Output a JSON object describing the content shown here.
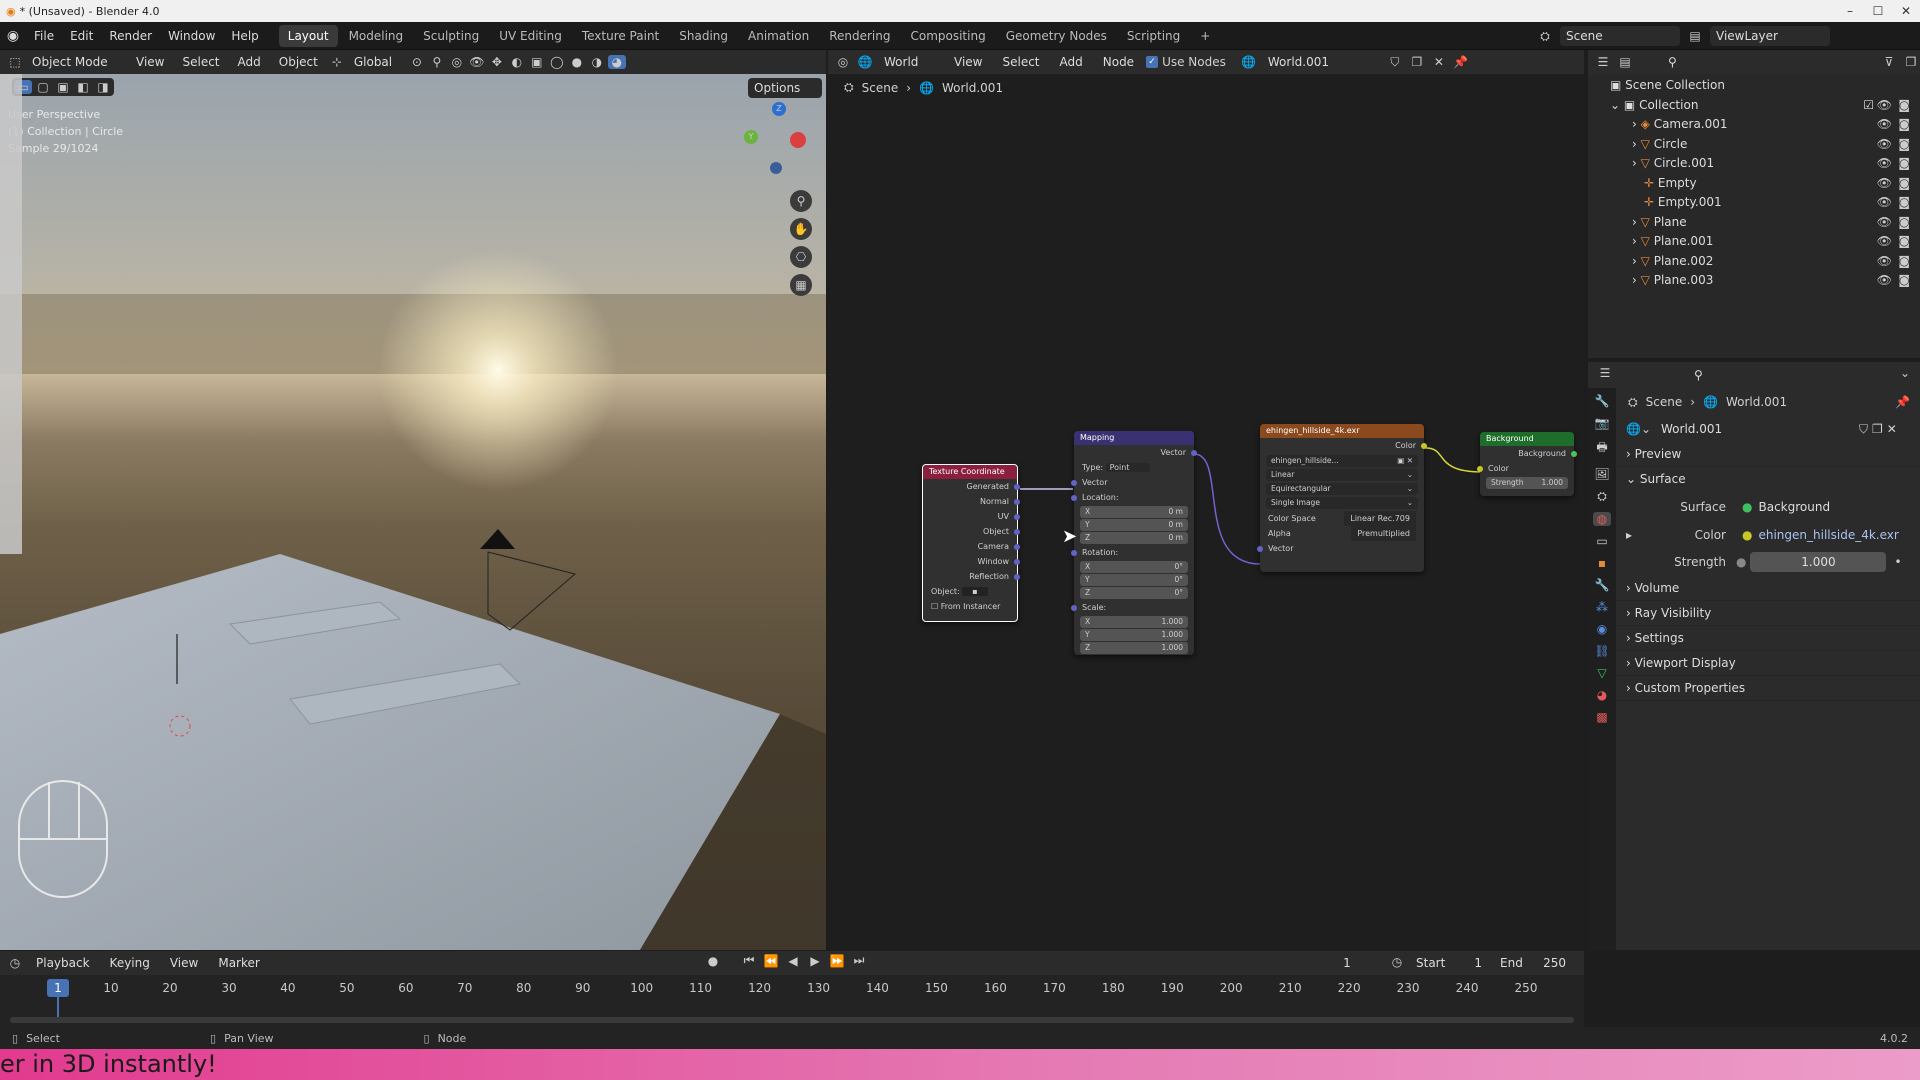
{
  "window": {
    "title": "* (Unsaved) - Blender 4.0"
  },
  "menu": [
    "File",
    "Edit",
    "Render",
    "Window",
    "Help"
  ],
  "workspaces": [
    "Layout",
    "Modeling",
    "Sculpting",
    "UV Editing",
    "Texture Paint",
    "Shading",
    "Animation",
    "Rendering",
    "Compositing",
    "Geometry Nodes",
    "Scripting"
  ],
  "top_right": {
    "scene": "Scene",
    "view_layer": "ViewLayer"
  },
  "viewport": {
    "mode": "Object Mode",
    "menus": [
      "View",
      "Select",
      "Add",
      "Object"
    ],
    "orientation": "Global",
    "options": "Options",
    "overlay_lines": [
      "User Perspective",
      "(1) Collection | Circle",
      "Sample 29/1024"
    ]
  },
  "node_editor": {
    "type": "World",
    "menus": [
      "View",
      "Select",
      "Add",
      "Node"
    ],
    "use_nodes": "Use Nodes",
    "world_name": "World.001",
    "breadcrumb": [
      "Scene",
      "World.001"
    ],
    "nodes": {
      "texcoord": {
        "title": "Texture Coordinate",
        "outputs": [
          "Generated",
          "Normal",
          "UV",
          "Object",
          "Camera",
          "Window",
          "Reflection"
        ],
        "object_label": "Object:",
        "from_instancer": "From Instancer"
      },
      "mapping": {
        "title": "Mapping",
        "output": "Vector",
        "type_label": "Type:",
        "type_value": "Point",
        "input_vector": "Vector",
        "location": "Location:",
        "rotation": "Rotation:",
        "scale": "Scale:",
        "loc": [
          "0 m",
          "0 m",
          "0 m"
        ],
        "rot": [
          "0°",
          "0°",
          "0°"
        ],
        "scl": [
          "1.000",
          "1.000",
          "1.000"
        ],
        "axes": [
          "X",
          "Y",
          "Z"
        ]
      },
      "envtex": {
        "title": "ehingen_hillside_4k.exr",
        "output": "Color",
        "image": "ehingen_hillside...",
        "interp": "Linear",
        "projection": "Equirectangular",
        "extension": "Single Image",
        "cs_label": "Color Space",
        "cs_value": "Linear Rec.709",
        "alpha_label": "Alpha",
        "alpha_value": "Premultiplied",
        "input": "Vector"
      },
      "background": {
        "title": "Background",
        "output": "Background",
        "color": "Color",
        "strength_label": "Strength",
        "strength_value": "1.000"
      }
    }
  },
  "outliner": {
    "root": "Scene Collection",
    "collection": "Collection",
    "items": [
      "Camera.001",
      "Circle",
      "Circle.001",
      "Empty",
      "Empty.001",
      "Plane",
      "Plane.001",
      "Plane.002",
      "Plane.003"
    ]
  },
  "properties": {
    "breadcrumb": [
      "Scene",
      "World.001"
    ],
    "world": "World.001",
    "sections": {
      "preview": "Preview",
      "surface": "Surface",
      "volume": "Volume",
      "ray_visibility": "Ray Visibility",
      "settings": "Settings",
      "viewport_display": "Viewport Display",
      "custom_properties": "Custom Properties"
    },
    "surface_label": "Surface",
    "surface_value": "Background",
    "color_label": "Color",
    "color_value": "ehingen_hillside_4k.exr",
    "strength_label": "Strength",
    "strength_value": "1.000"
  },
  "timeline": {
    "menus": [
      "Playback",
      "Keying",
      "View",
      "Marker"
    ],
    "current_frame": "1",
    "start_label": "Start",
    "start": "1",
    "end_label": "End",
    "end": "250",
    "ticks": [
      "1",
      "10",
      "20",
      "30",
      "40",
      "50",
      "60",
      "70",
      "80",
      "90",
      "100",
      "110",
      "120",
      "130",
      "140",
      "150",
      "160",
      "170",
      "180",
      "190",
      "200",
      "210",
      "220",
      "230",
      "240",
      "250"
    ]
  },
  "statusbar": {
    "select": "Select",
    "pan": "Pan View",
    "node": "Node",
    "version": "4.0.2"
  },
  "banner": {
    "text": "er in 3D instantly!"
  },
  "colors": {
    "texcoord_header": "#8b1f3f",
    "mapping_header": "#3a3173",
    "envtex_header": "#8a4a1e",
    "background_header": "#1f6d2a",
    "accent": "#4772b3"
  }
}
